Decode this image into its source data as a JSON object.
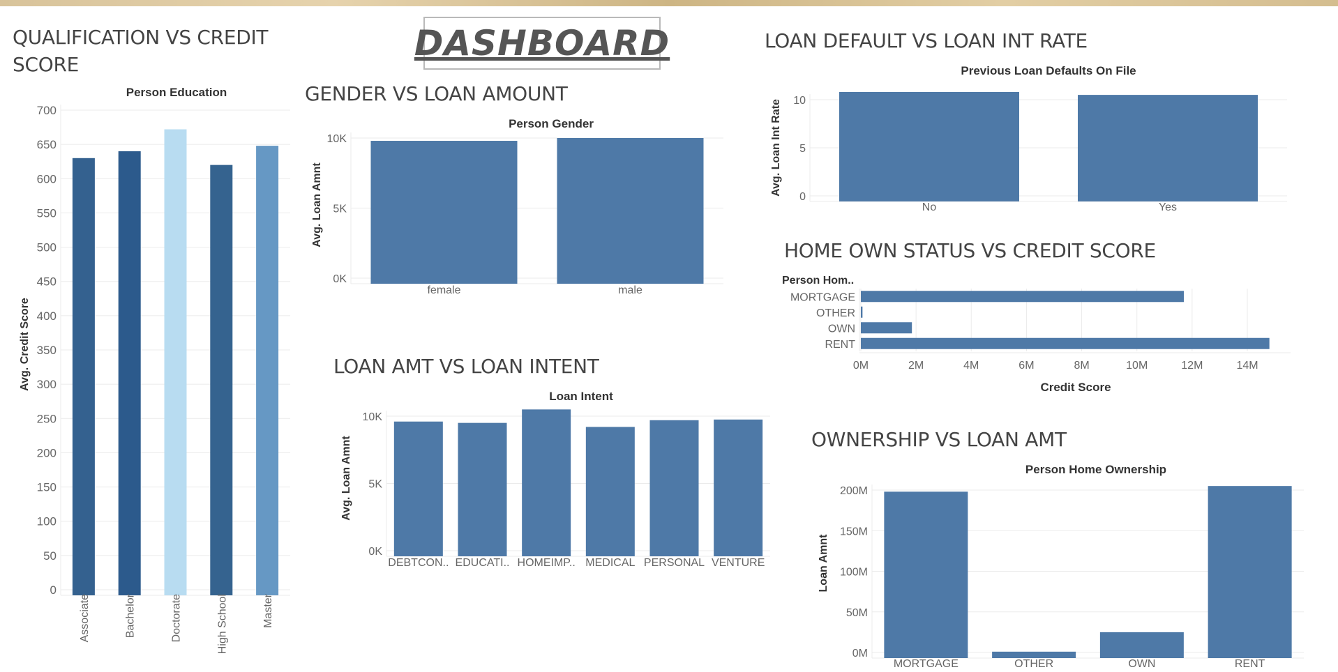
{
  "dashboard_title": "DASHBOARD",
  "colors": {
    "bar": "#4e79a7",
    "grid": "#ebebeb",
    "axis_text": "#666666",
    "header_text": "#333333"
  },
  "sheets": {
    "qualification": {
      "title": "QUALIFICATION VS CREDIT SCORE"
    },
    "gender": {
      "title": "GENDER VS LOAN AMOUNT"
    },
    "intent": {
      "title": "LOAN AMT VS LOAN INTENT"
    },
    "default": {
      "title": "LOAN DEFAULT VS LOAN INT RATE"
    },
    "home_status": {
      "title": "HOME OWN STATUS VS CREDIT SCORE"
    },
    "ownership": {
      "title": "OWNERSHIP VS LOAN AMT"
    }
  },
  "chart_data": [
    {
      "id": "qualification",
      "type": "bar",
      "header": "Person Education",
      "ylabel": "Avg. Credit Score",
      "categories": [
        "Associate",
        "Bachelor",
        "Doctorate",
        "High School",
        "Master"
      ],
      "values": [
        630,
        640,
        672,
        620,
        648
      ],
      "bar_colors": [
        "#34618f",
        "#2c5a8c",
        "#b8dcf1",
        "#35638f",
        "#6698c4"
      ],
      "ylim": [
        0,
        700
      ],
      "yticks": [
        0,
        50,
        100,
        150,
        200,
        250,
        300,
        350,
        400,
        450,
        500,
        550,
        600,
        650,
        700
      ],
      "ytick_labels": [
        "0",
        "50",
        "100",
        "150",
        "200",
        "250",
        "300",
        "350",
        "400",
        "450",
        "500",
        "550",
        "600",
        "650",
        "700"
      ],
      "grid": true
    },
    {
      "id": "gender",
      "type": "bar",
      "header": "Person Gender",
      "ylabel": "Avg. Loan Amnt",
      "categories": [
        "female",
        "male"
      ],
      "values": [
        9800,
        10000
      ],
      "ylim": [
        0,
        10000
      ],
      "yticks": [
        0,
        5000,
        10000
      ],
      "ytick_labels": [
        "0K",
        "5K",
        "10K"
      ],
      "grid": true
    },
    {
      "id": "intent",
      "type": "bar",
      "header": "Loan Intent",
      "ylabel": "Avg. Loan Amnt",
      "categories": [
        "DEBTCON..",
        "EDUCATI..",
        "HOMEIMP..",
        "MEDICAL",
        "PERSONAL",
        "VENTURE"
      ],
      "values": [
        9600,
        9500,
        10500,
        9200,
        9700,
        9750
      ],
      "ylim": [
        0,
        10000
      ],
      "yticks": [
        0,
        5000,
        10000
      ],
      "ytick_labels": [
        "0K",
        "5K",
        "10K"
      ],
      "grid": true
    },
    {
      "id": "default",
      "type": "bar",
      "header": "Previous Loan Defaults On File",
      "ylabel": "Avg. Loan Int Rate",
      "categories": [
        "No",
        "Yes"
      ],
      "values": [
        11.7,
        10.5
      ],
      "ylim": [
        0,
        10
      ],
      "yticks": [
        0,
        5,
        10
      ],
      "ytick_labels": [
        "0",
        "5",
        "10"
      ],
      "grid": true
    },
    {
      "id": "home_status",
      "type": "bar",
      "orientation": "horizontal",
      "row_header": "Person Hom..",
      "xlabel": "Credit Score",
      "categories": [
        "MORTGAGE",
        "OTHER",
        "OWN",
        "RENT"
      ],
      "values": [
        11700000,
        60000,
        1850000,
        14800000
      ],
      "xlim": [
        0,
        14000000
      ],
      "xticks": [
        0,
        2000000,
        4000000,
        6000000,
        8000000,
        10000000,
        12000000,
        14000000
      ],
      "xtick_labels": [
        "0M",
        "2M",
        "4M",
        "6M",
        "8M",
        "10M",
        "12M",
        "14M"
      ],
      "grid": true
    },
    {
      "id": "ownership",
      "type": "bar",
      "header": "Person Home Ownership",
      "ylabel": "Loan Amnt",
      "categories": [
        "MORTGAGE",
        "OTHER",
        "OWN",
        "RENT"
      ],
      "values": [
        198000000,
        1000000,
        25000000,
        205000000
      ],
      "ylim": [
        0,
        200000000
      ],
      "yticks": [
        0,
        50000000,
        100000000,
        150000000,
        200000000
      ],
      "ytick_labels": [
        "0M",
        "50M",
        "100M",
        "150M",
        "200M"
      ],
      "grid": true
    }
  ]
}
